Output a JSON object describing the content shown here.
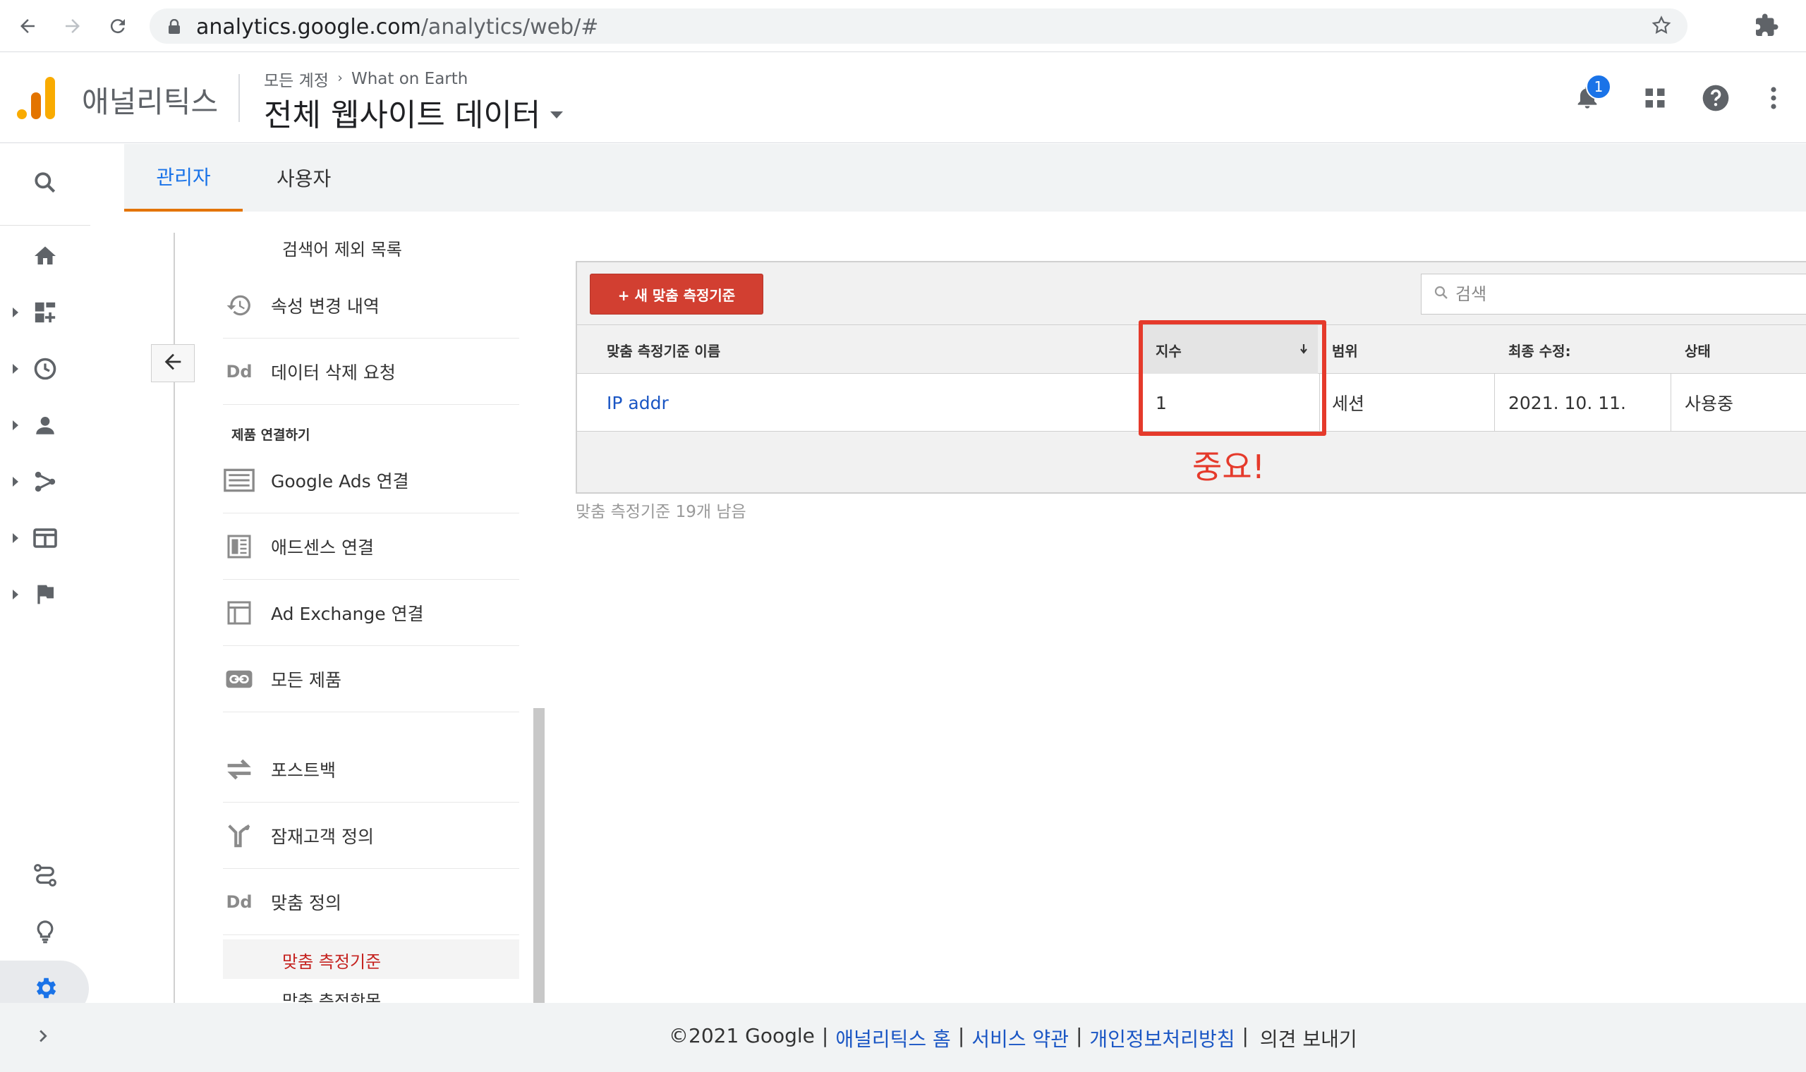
{
  "browser": {
    "url_host": "analytics.google.com",
    "url_path": "/analytics/web/#"
  },
  "header": {
    "app_name": "애널리틱스",
    "breadcrumb_account": "모든 계정",
    "breadcrumb_property": "What on Earth",
    "view_name": "전체 웹사이트 데이터",
    "notification_count": "1"
  },
  "tabs": [
    {
      "label": "관리자"
    },
    {
      "label": "사용자"
    }
  ],
  "property_menu": {
    "items": [
      {
        "label": "검색어 제외 목록"
      },
      {
        "label": "속성 변경 내역",
        "icon": "history-icon"
      },
      {
        "label": "데이터 삭제 요청",
        "icon": "dd-icon",
        "icon_text": "Dd"
      },
      {
        "label": "Google Ads 연결",
        "icon": "ads-icon"
      },
      {
        "label": "애드센스 연결",
        "icon": "adsense-icon"
      },
      {
        "label": "Ad Exchange 연결",
        "icon": "ad-exchange-icon"
      },
      {
        "label": "모든 제품",
        "icon": "link-icon"
      },
      {
        "label": "포스트백",
        "icon": "postback-icon"
      },
      {
        "label": "잠재고객 정의",
        "icon": "audience-icon"
      },
      {
        "label": "맞춤 정의",
        "icon": "dd-icon",
        "icon_text": "Dd"
      },
      {
        "label": "맞춤 측정기준"
      },
      {
        "label": "맞춤 측정항목"
      }
    ],
    "section_label": "제품 연결하기"
  },
  "table": {
    "new_button_label": "+ 새 맞춤 측정기준",
    "search_placeholder": "검색",
    "columns": [
      "맞춤 측정기준 이름",
      "지수",
      "범위",
      "최종 수정:",
      "상태"
    ],
    "rows": [
      {
        "name": "IP addr",
        "index": "1",
        "scope": "세션",
        "modified": "2021. 10. 11.",
        "status": "사용중"
      }
    ],
    "remaining_text": "맞춤 측정기준 19개 남음"
  },
  "annotation": {
    "text": "중요!",
    "color": "#e53a2b"
  },
  "footer": {
    "copyright": "©2021 Google",
    "sep": "|",
    "link_home": "애널리틱스 홈",
    "link_terms": "서비스 약관",
    "link_privacy": "개인정보처리방침",
    "feedback": "의견 보내기"
  },
  "colors": {
    "accent_blue": "#1a73e8",
    "tab_underline": "#e37400",
    "button_red": "#d23f31",
    "active_item_red": "#c5221f"
  }
}
